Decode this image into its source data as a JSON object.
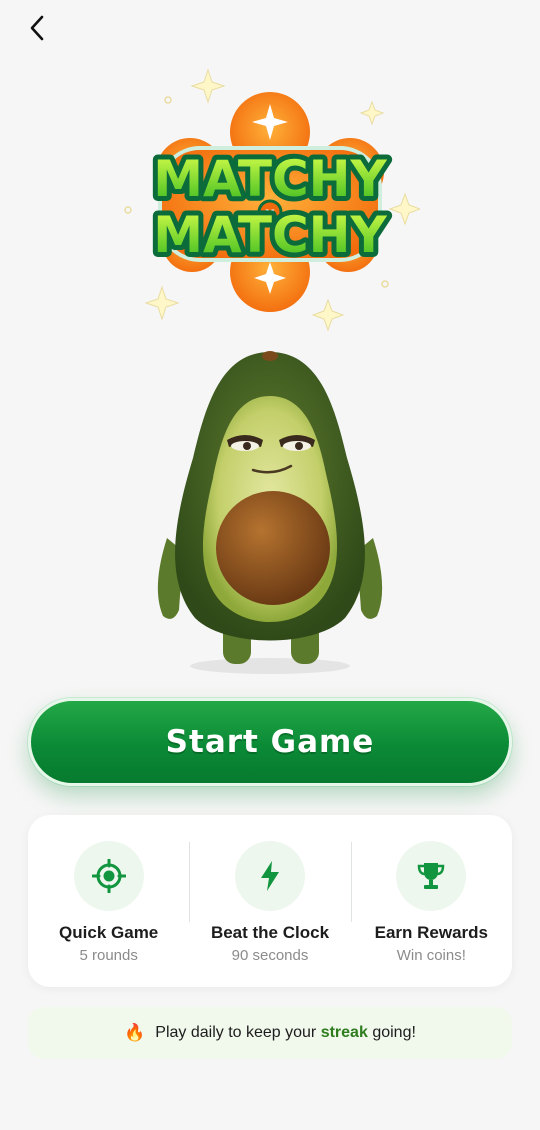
{
  "header": {
    "back_icon": "chevron-left-icon"
  },
  "logo": {
    "line1": "MATCHY",
    "connector": "x",
    "line2": "MATCHY"
  },
  "start_button": {
    "label": "Start Game"
  },
  "features": [
    {
      "title": "Quick Game",
      "subtitle": "5 rounds",
      "icon": "target-icon"
    },
    {
      "title": "Beat the Clock",
      "subtitle": "90 seconds",
      "icon": "lightning-icon"
    },
    {
      "title": "Earn Rewards",
      "subtitle": "Win coins!",
      "icon": "trophy-icon"
    }
  ],
  "streak": {
    "icon": "fire-icon",
    "prefix": "Play daily to keep your",
    "highlight": "streak",
    "suffix": "going!"
  },
  "colors": {
    "accent_green": "#0b8a36",
    "icon_green": "#12953f",
    "streak_green": "#2f7d1e",
    "background": "#f6f6f6"
  }
}
